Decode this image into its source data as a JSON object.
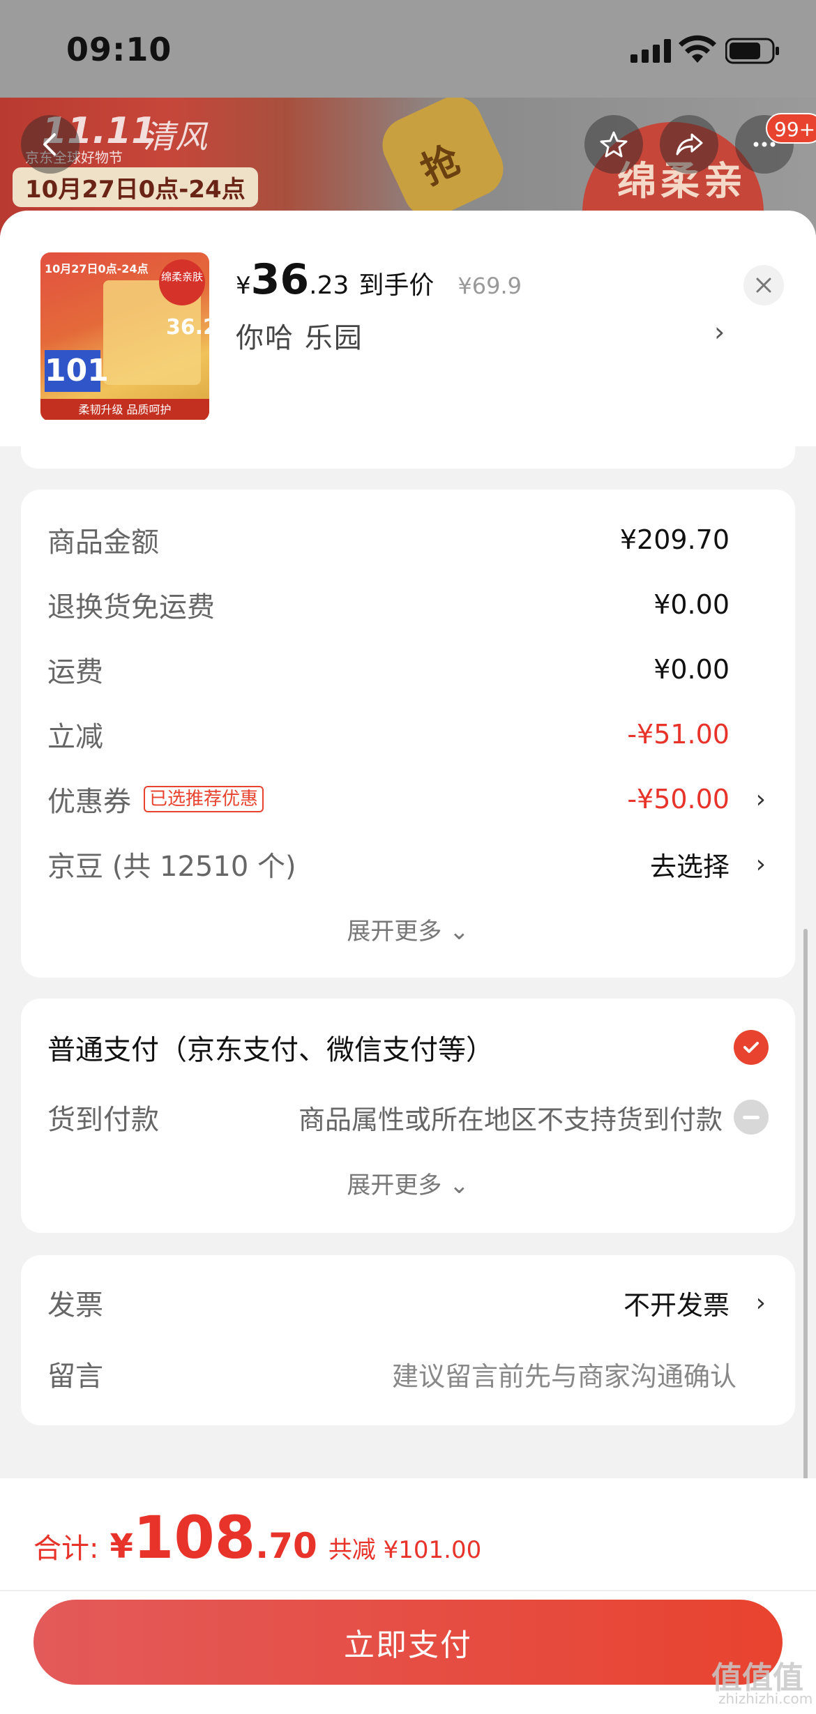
{
  "status_bar": {
    "time": "09:10"
  },
  "banner": {
    "brand": "11.11",
    "brand_name": "清风",
    "subtitle": "京东全球好物节",
    "promo_time": "10月27日0点-24点",
    "gold_label": "抢",
    "circle_text": "绵柔亲肤",
    "notification_badge": "99+"
  },
  "product": {
    "currency": "¥",
    "price_int": "36",
    "price_dec": ".23",
    "price_label": "到手价",
    "original_price": "¥69.9",
    "spec": "你哈  乐园",
    "spec_arrow": "›",
    "thumb": {
      "top_text": "10月27日0点-24点",
      "badge": "绵柔亲肤",
      "price": "36.2",
      "count": "101",
      "footer": "柔韧升级 品质呵护"
    }
  },
  "price_detail": {
    "rows": [
      {
        "label": "商品金额",
        "value": "¥209.70"
      },
      {
        "label": "退换货免运费",
        "value": "¥0.00"
      },
      {
        "label": "运费",
        "value": "¥0.00"
      },
      {
        "label": "立减",
        "value": "-¥51.00"
      },
      {
        "label": "优惠券",
        "tag": "已选推荐优惠",
        "value": "-¥50.00"
      },
      {
        "label": "京豆 (共 12510 个)",
        "value": "去选择"
      }
    ],
    "expand_more": "展开更多 ⌄"
  },
  "payment": {
    "normal": "普通支付（京东支付、微信支付等）",
    "cod_label": "货到付款",
    "cod_note": "商品属性或所在地区不支持货到付款",
    "expand_more": "展开更多 ⌄"
  },
  "extra": {
    "invoice_label": "发票",
    "invoice_value": "不开发票",
    "message_label": "留言",
    "message_placeholder": "建议留言前先与商家沟通确认"
  },
  "footer": {
    "total_label": "合计:",
    "currency": "¥",
    "total_int": "108",
    "total_dec": ".70",
    "savings": "共减 ¥101.00",
    "pay_button": "立即支付"
  },
  "watermark": {
    "text": "值值值",
    "domain": "zhizhizhi.com"
  },
  "colors": {
    "accent": "#e8432f",
    "background": "#f2f2f2"
  }
}
